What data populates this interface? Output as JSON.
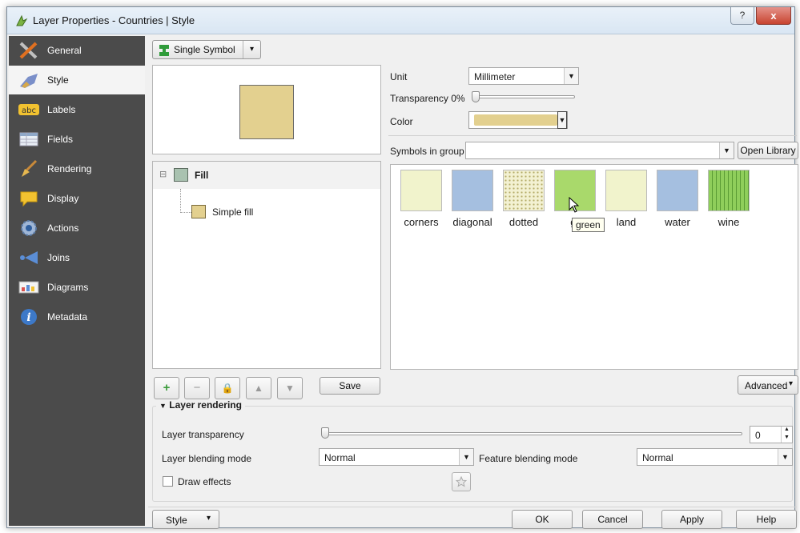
{
  "window": {
    "title": "Layer Properties - Countries | Style",
    "help_glyph": "?",
    "close_glyph": "x"
  },
  "sidebar": {
    "items": [
      {
        "label": "General",
        "icon": "tools-icon"
      },
      {
        "label": "Style",
        "icon": "paintbrush-icon"
      },
      {
        "label": "Labels",
        "icon": "abc-label-icon",
        "icon_text": "abc"
      },
      {
        "label": "Fields",
        "icon": "table-icon"
      },
      {
        "label": "Rendering",
        "icon": "broom-icon"
      },
      {
        "label": "Display",
        "icon": "speech-bubble-icon"
      },
      {
        "label": "Actions",
        "icon": "gear-icon"
      },
      {
        "label": "Joins",
        "icon": "join-arrow-icon"
      },
      {
        "label": "Diagrams",
        "icon": "chart-icon"
      },
      {
        "label": "Metadata",
        "icon": "info-icon",
        "icon_text": "i"
      }
    ],
    "active": "Style"
  },
  "renderer": {
    "type_label": "Single Symbol",
    "arrow": "▾"
  },
  "preview": {
    "fill_color": "#e3d08f"
  },
  "symbol_tree": {
    "root_label": "Fill",
    "root_color": "#a9c2b0",
    "expander": "⊟",
    "child_label": "Simple fill",
    "child_color": "#e3d08f"
  },
  "layer_buttons": {
    "add": "+",
    "remove": "−",
    "lock": "🔒",
    "up": "▲",
    "down": "▼",
    "save_label": "Save"
  },
  "props": {
    "unit_label": "Unit",
    "unit_value": "Millimeter",
    "transparency_label": "Transparency 0%",
    "transparency_value": 0,
    "color_label": "Color",
    "color_value": "#e3d08f"
  },
  "library": {
    "group_label": "Symbols in group",
    "group_value": "",
    "open_library_label": "Open Library",
    "symbols": [
      {
        "name": "corners",
        "color": "#f1f3cc"
      },
      {
        "name": "diagonal",
        "color": "#a5bfe0"
      },
      {
        "name": "dotted",
        "color": "#f3f1d2"
      },
      {
        "name": "green",
        "display": "gr",
        "color": "#a9d96b"
      },
      {
        "name": "land",
        "color": "#f1f3cc"
      },
      {
        "name": "water",
        "color": "#a5bfe0"
      },
      {
        "name": "wine",
        "color": "#8fce5b"
      }
    ],
    "tooltip": "green",
    "advanced_label": "Advanced",
    "advanced_arrow": "▾"
  },
  "layer_rendering": {
    "section_title": "Layer rendering",
    "collapse_glyph": "▼",
    "transparency_label": "Layer transparency",
    "transparency_value": "0",
    "blending_label": "Layer blending mode",
    "blending_value": "Normal",
    "feature_blending_label": "Feature blending mode",
    "feature_blending_value": "Normal",
    "draw_effects_label": "Draw effects",
    "spin_up": "▲",
    "spin_down": "▼"
  },
  "footer": {
    "style_label": "Style",
    "style_arrow": "▾",
    "ok": "OK",
    "cancel": "Cancel",
    "apply": "Apply",
    "help": "Help"
  }
}
